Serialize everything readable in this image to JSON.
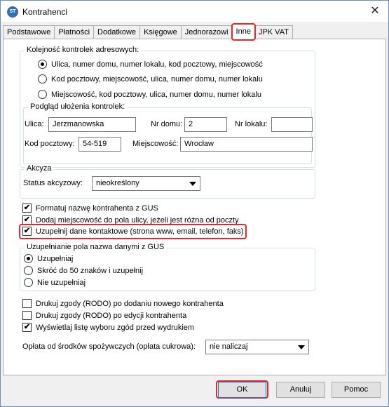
{
  "window": {
    "icon_text": "ST",
    "title": "Kontrahenci",
    "close_glyph": "✕"
  },
  "tabs": [
    "Podstawowe",
    "Płatności",
    "Dodatkowe",
    "Księgowe",
    "Jednorazowi",
    "Inne",
    "JPK VAT"
  ],
  "active_tab": "Inne",
  "address_order": {
    "title": "Kolejność kontrolek adresowych:",
    "options": [
      "Ulica, numer domu, numer lokalu, kod pocztowy, miejscowość",
      "Kod pocztowy, miejscowość, ulica, numer domu, numer lokalu",
      "Miejscowość, kod pocztowy, ulica, numer domu, numer lokalu"
    ],
    "selected_index": 0
  },
  "preview": {
    "title": "Podgląd ułożenia kontrolek:",
    "street_label": "Ulica:",
    "street_value": "Jerzmanowska",
    "house_label": "Nr domu:",
    "house_value": "2",
    "flat_label": "Nr lokalu:",
    "flat_value": "",
    "postal_label": "Kod pocztowy:",
    "postal_value": "54-519",
    "city_label": "Miejscowość:",
    "city_value": "Wrocław"
  },
  "excise": {
    "title": "Akcyza",
    "status_label": "Status akcyzowy:",
    "status_value": "nieokreślony"
  },
  "checks_top": [
    {
      "label": "Formatuj nazwę kontrahenta z GUS",
      "checked": true
    },
    {
      "label": "Dodaj miejscowość do pola ulicy, jeżeli jest różna od poczty",
      "checked": true
    },
    {
      "label": "Uzupełnij dane kontaktowe (strona www, email, telefon, faks)",
      "checked": true
    }
  ],
  "gus_fill": {
    "title": "Uzupełnianie pola nazwa danymi z GUS",
    "options": [
      "Uzupełniaj",
      "Skróć do 50 znaków i uzupełnij",
      "Nie uzupełniaj"
    ],
    "selected_index": 0
  },
  "checks_bottom": [
    {
      "label": "Drukuj zgody (RODO) po dodaniu nowego kontrahenta",
      "checked": false
    },
    {
      "label": "Drukuj zgody (RODO) po edycji kontrahenta",
      "checked": false
    },
    {
      "label": "Wyświetlaj listę wyboru zgód przed wydrukiem",
      "checked": true
    }
  ],
  "sugar_fee": {
    "label": "Opłata od środków spożywczych (opłata cukrowa):",
    "value": "nie naliczaj"
  },
  "check_glyph": "✔",
  "buttons": {
    "ok": "OK",
    "cancel": "Anuluj",
    "help": "Pomoc"
  },
  "highlight_color": "#e8262a"
}
